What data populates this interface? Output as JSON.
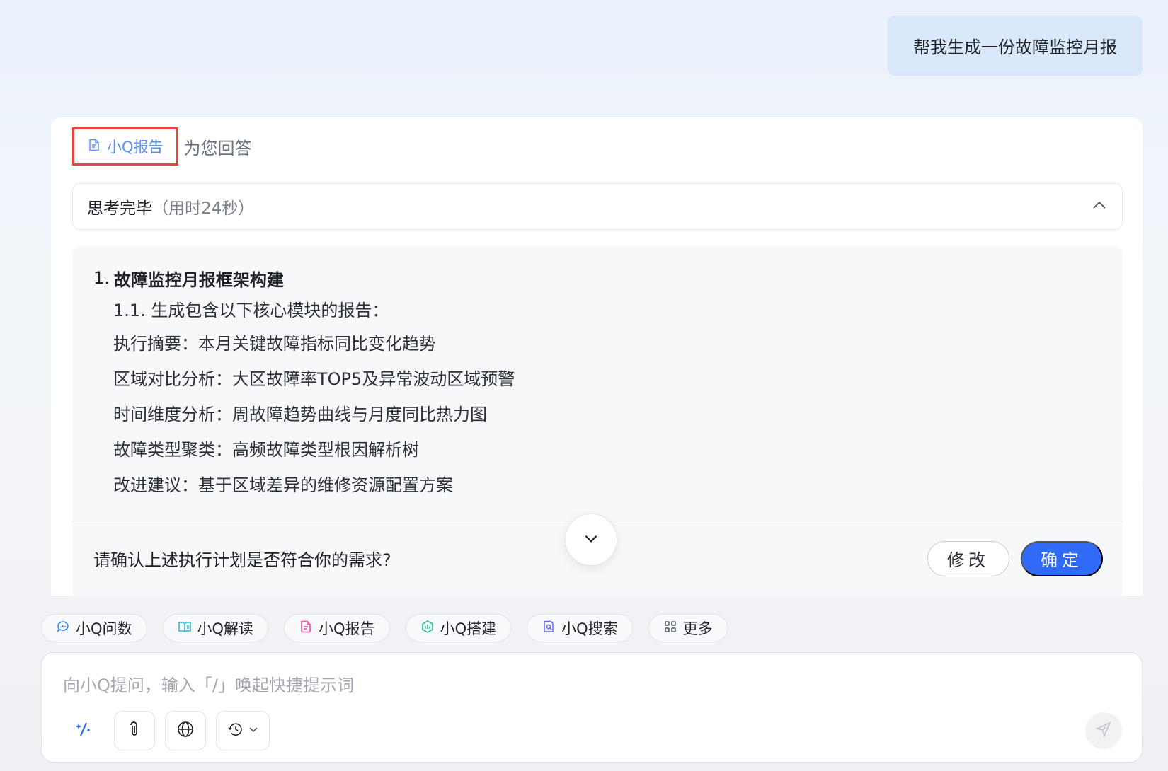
{
  "user_message": "帮我生成一份故障监控月报",
  "answer": {
    "source_tag": "小Q报告",
    "source_suffix": "为您回答",
    "thinking": {
      "status": "思考完毕",
      "time": "（用时24秒）"
    },
    "plan": {
      "heading_num": "1.",
      "heading": "故障监控月报框架构建",
      "sub": "1.1. 生成包含以下核心模块的报告：",
      "items": [
        "执行摘要：本月关键故障指标同比变化趋势",
        "区域对比分析：大区故障率TOP5及异常波动区域预警",
        "时间维度分析：周故障趋势曲线与月度同比热力图",
        "故障类型聚类：高频故障类型根因解析树",
        "改进建议：基于区域差异的维修资源配置方案"
      ]
    },
    "confirm": {
      "question": "请确认上述执行计划是否符合你的需求?",
      "modify_label": "修改",
      "confirm_label": "确定"
    }
  },
  "quick_chips": [
    {
      "label": "小Q问数",
      "icon": "chat-data-icon",
      "color": "#3b82f6"
    },
    {
      "label": "小Q解读",
      "icon": "book-icon",
      "color": "#22b8cf"
    },
    {
      "label": "小Q报告",
      "icon": "report-icon",
      "color": "#ec4899"
    },
    {
      "label": "小Q搭建",
      "icon": "build-icon",
      "color": "#10b981"
    },
    {
      "label": "小Q搜索",
      "icon": "search-doc-icon",
      "color": "#6366f1"
    },
    {
      "label": "更多",
      "icon": "grid-icon",
      "color": "#4b5563"
    }
  ],
  "input": {
    "placeholder": "向小Q提问，输入「/」唤起快捷提示词"
  },
  "colors": {
    "accent": "#2f6bf6",
    "source_tag": "#5b8ff0",
    "highlight_border": "#e8463a"
  }
}
